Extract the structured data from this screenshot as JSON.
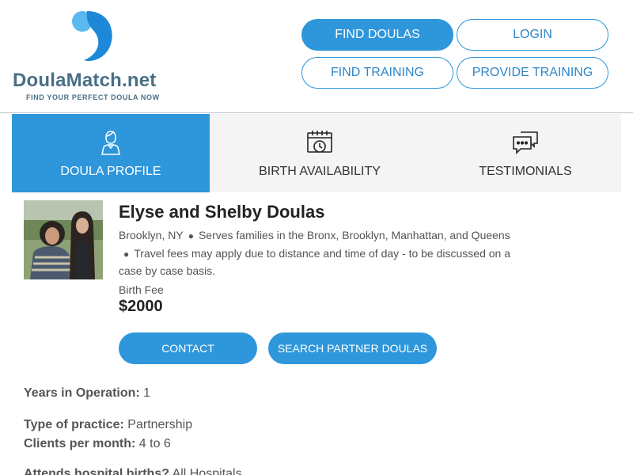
{
  "header": {
    "logo": {
      "name_part1": "Doula",
      "name_part2": "Match.net",
      "tagline": "FIND YOUR PERFECT DOULA NOW"
    },
    "nav": {
      "find_doulas": "FIND DOULAS",
      "login": "LOGIN",
      "find_training": "FIND TRAINING",
      "provide_training": "PROVIDE TRAINING"
    }
  },
  "tabs": [
    {
      "label": "DOULA PROFILE",
      "icon": "person-icon",
      "active": true
    },
    {
      "label": "BIRTH AVAILABILITY",
      "icon": "calendar-clock-icon",
      "active": false
    },
    {
      "label": "TESTIMONIALS",
      "icon": "chat-bubbles-icon",
      "active": false
    }
  ],
  "profile": {
    "name": "Elyse and Shelby Doulas",
    "location": "Brooklyn, NY",
    "service_area": "Serves families in the Bronx, Brooklyn, Manhattan, and Queens",
    "travel_note": "Travel fees may apply due to distance and time of day - to be discussed on a case by case basis.",
    "fee_label": "Birth Fee",
    "fee_value": "$2000",
    "contact_label": "CONTACT",
    "partner_label": "SEARCH PARTNER DOULAS"
  },
  "details": [
    {
      "label": "Years in Operation:",
      "value": "1"
    },
    {
      "label": "Type of practice:",
      "value": "Partnership"
    },
    {
      "label": "Clients per month:",
      "value": "4 to 6"
    },
    {
      "label": "Attends hospital births?",
      "value": "All Hospitals"
    }
  ],
  "colors": {
    "accent": "#2e96db",
    "logo_text": "#4a6f86",
    "tab_bg": "#f4f4f4"
  }
}
